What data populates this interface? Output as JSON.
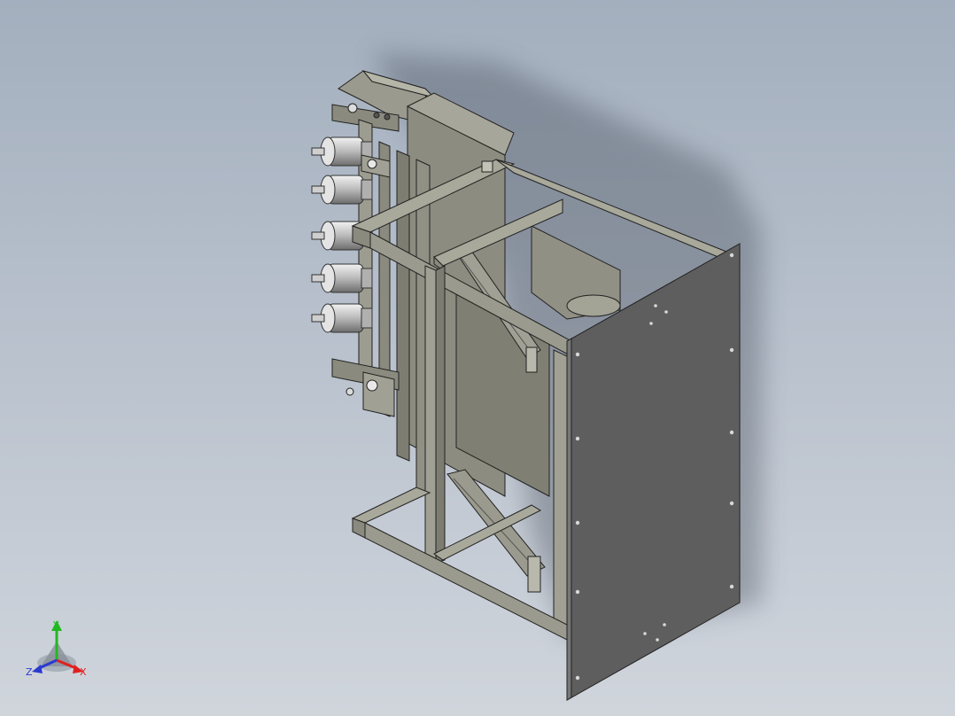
{
  "viewport": {
    "background_top": "#a3afbe",
    "background_bottom": "#d0d5dc"
  },
  "model": {
    "body_color": "#8f8f82",
    "panel_color": "#5e5e5e",
    "metal_color": "#c9c9c9"
  },
  "triad": {
    "x_label": "X",
    "y_label": "Y",
    "z_label": "Z",
    "x_color": "#e02020",
    "y_color": "#22b822",
    "z_color": "#2a3ad0"
  }
}
